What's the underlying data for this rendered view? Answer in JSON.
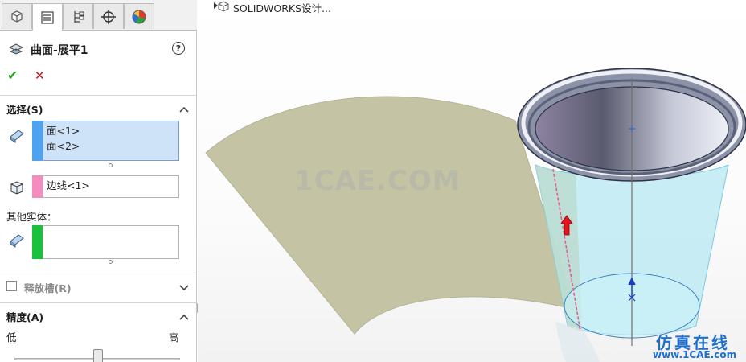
{
  "tabs": [
    {
      "icon": "feature-manager-icon",
      "active": false
    },
    {
      "icon": "property-manager-icon",
      "active": true
    },
    {
      "icon": "configuration-manager-icon",
      "active": false
    },
    {
      "icon": "dimxpert-manager-icon",
      "active": false
    },
    {
      "icon": "display-manager-icon",
      "active": false
    }
  ],
  "property_manager": {
    "title": "曲面-展平1",
    "help_symbol": "?",
    "ok_symbol": "✔",
    "cancel_symbol": "✕"
  },
  "selections": {
    "header": "选择(S)",
    "faces": [
      "面<1>",
      "面<2>"
    ],
    "face_bar_color": "#4da3f0",
    "edge_value": "边线<1>",
    "edge_bar_color": "#f48cc0"
  },
  "other_bodies": {
    "label": "其他实体：",
    "bar_color": "#19c13d",
    "value": ""
  },
  "relief_slots": {
    "label": "释放槽(R)",
    "checked": false
  },
  "accuracy": {
    "header": "精度(A)",
    "low_label": "低",
    "high_label": "高"
  },
  "tree": {
    "root_label": "SOLIDWORKS设计..."
  },
  "watermarks": {
    "center": "1CAE.COM",
    "cn": "仿真在线",
    "url": "www.1CAE.com"
  }
}
